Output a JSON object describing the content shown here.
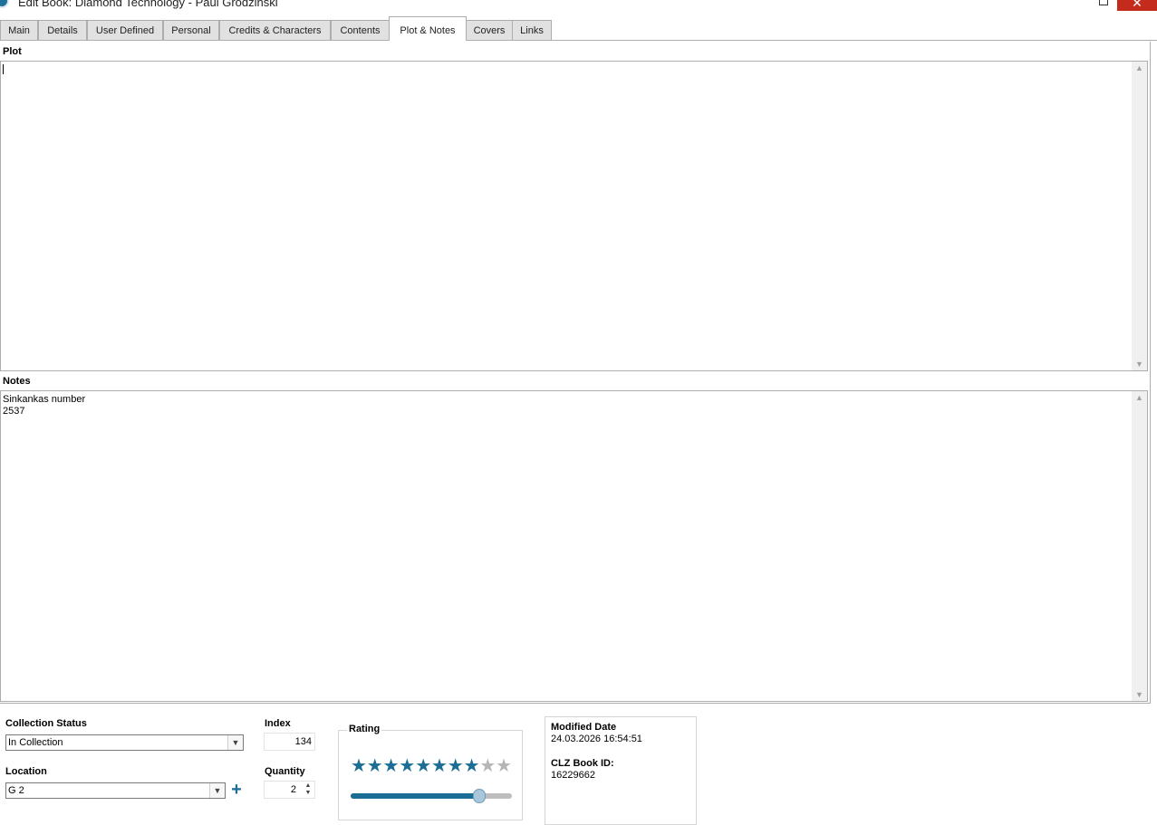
{
  "window": {
    "title": "Edit Book: Diamond Technology - Paul Grodzinski",
    "close_glyph": "✕"
  },
  "tabs": [
    {
      "label": "Main"
    },
    {
      "label": "Details"
    },
    {
      "label": "User Defined"
    },
    {
      "label": "Personal"
    },
    {
      "label": "Credits & Characters"
    },
    {
      "label": "Contents"
    },
    {
      "label": "Plot & Notes",
      "active": true
    },
    {
      "label": "Covers"
    },
    {
      "label": "Links"
    }
  ],
  "plot": {
    "label": "Plot",
    "value": ""
  },
  "notes": {
    "label": "Notes",
    "value": "Sinkankas number\n2537"
  },
  "collection_status": {
    "label": "Collection Status",
    "value": "In Collection"
  },
  "location": {
    "label": "Location",
    "value": "G 2"
  },
  "index": {
    "label": "Index",
    "value": "134"
  },
  "quantity": {
    "label": "Quantity",
    "value": "2"
  },
  "rating": {
    "label": "Rating",
    "value": 8,
    "max": 10,
    "star_filled_color": "#1a6d94",
    "star_empty_color": "#b5b5b5"
  },
  "info": {
    "modified_label": "Modified Date",
    "modified_value": "24.03.2026 16:54:51",
    "clz_id_label": "CLZ Book ID:",
    "clz_id_value": "16229662"
  }
}
